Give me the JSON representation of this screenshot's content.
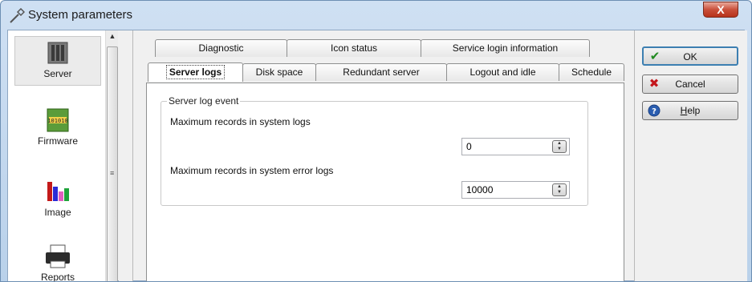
{
  "window": {
    "title": "System parameters",
    "close_label": "X"
  },
  "sidebar": {
    "items": [
      {
        "label": "Server",
        "icon": "server-icon"
      },
      {
        "label": "Firmware",
        "icon": "firmware-icon"
      },
      {
        "label": "Image",
        "icon": "image-icon"
      },
      {
        "label": "Reports",
        "icon": "printer-icon"
      }
    ]
  },
  "tabs": {
    "row_back": [
      "Diagnostic",
      "Icon status",
      "Service login information"
    ],
    "row_front": [
      "Server logs",
      "Disk space",
      "Redundant server",
      "Logout and idle",
      "Schedule"
    ],
    "active": "Server logs"
  },
  "panel": {
    "group_title": "Server log event",
    "fields": [
      {
        "label": "Maximum records in system logs",
        "value": "0"
      },
      {
        "label": "Maximum records in system error logs",
        "value": "10000"
      }
    ]
  },
  "buttons": {
    "ok": "OK",
    "cancel": "Cancel",
    "help_prefix": "H",
    "help_rest": "elp"
  },
  "colors": {
    "ok_check": "#1f8a1f",
    "cancel_x": "#c4161c",
    "help_circle": "#2a5db0"
  }
}
